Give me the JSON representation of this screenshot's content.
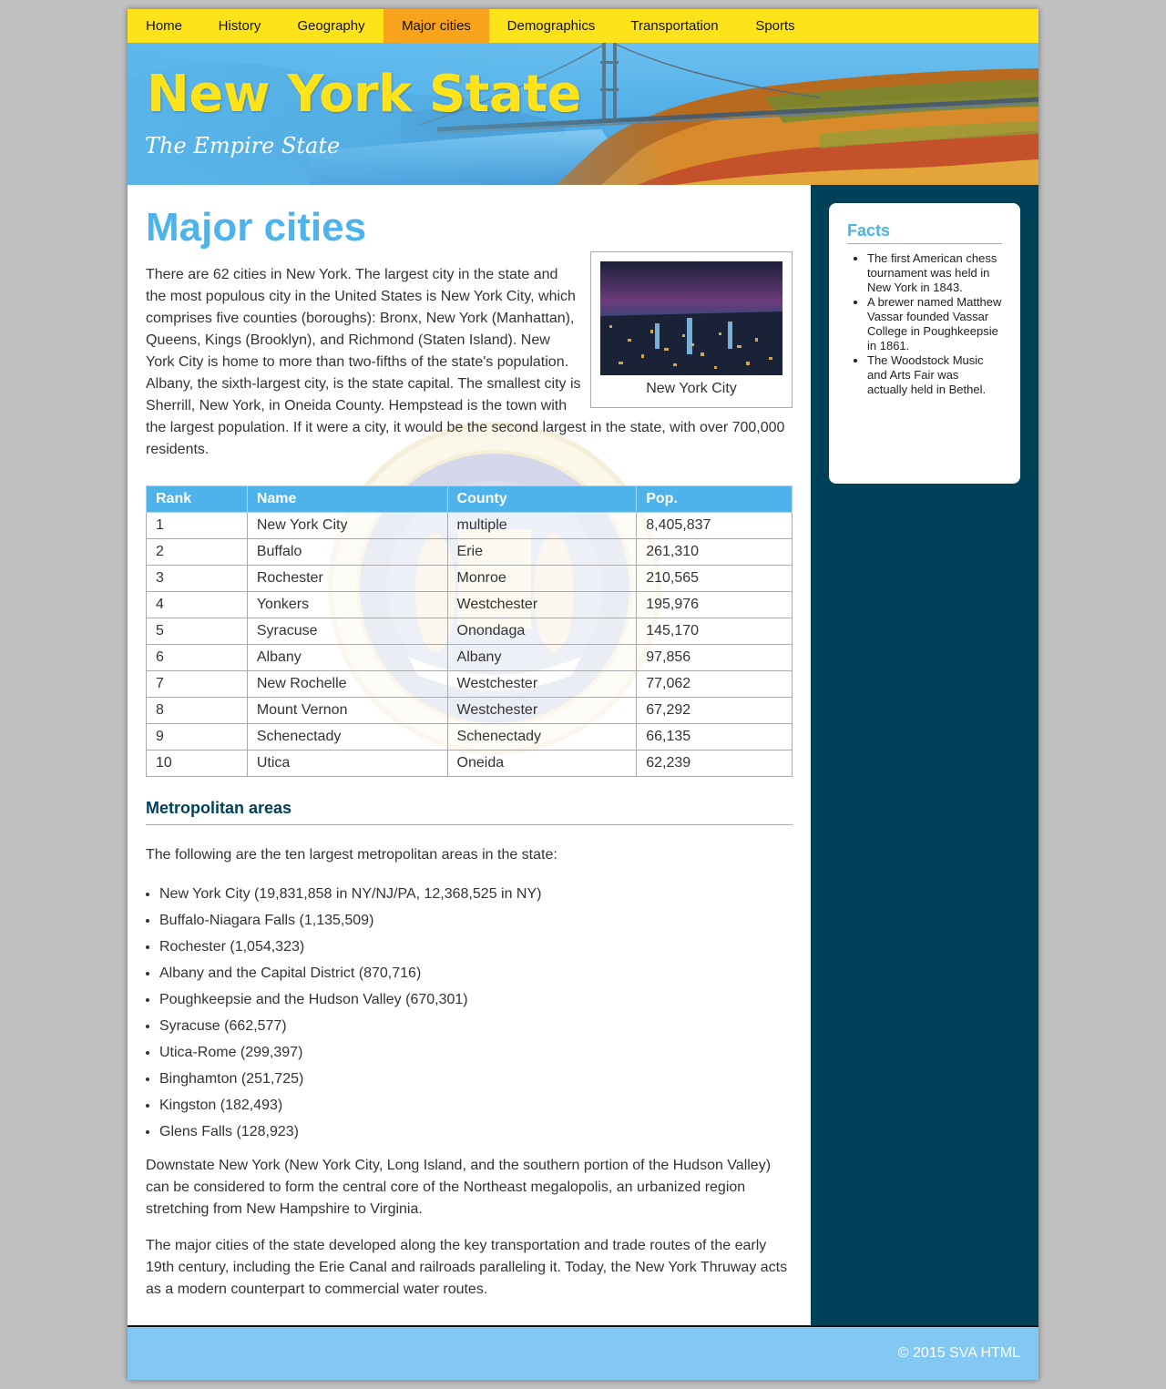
{
  "nav": {
    "items": [
      {
        "label": "Home",
        "active": false
      },
      {
        "label": "History",
        "active": false
      },
      {
        "label": "Geography",
        "active": false
      },
      {
        "label": "Major cities",
        "active": true
      },
      {
        "label": "Demographics",
        "active": false
      },
      {
        "label": "Transportation",
        "active": false
      },
      {
        "label": "Sports",
        "active": false
      }
    ]
  },
  "banner": {
    "title": "New York State",
    "tagline": "The Empire State"
  },
  "main": {
    "title": "Major cities",
    "intro": "There are 62 cities in New York. The largest city in the state and the most populous city in the United States is New York City, which comprises five counties (boroughs): Bronx, New York (Manhattan), Queens, Kings (Brooklyn), and Richmond (Staten Island). New York City is home to more than two-fifths of the state's population. Albany, the sixth-largest city, is the state capital. The smallest city is Sherrill, New York, in Oneida County. Hempstead is the town with the largest population. If it were a city, it would be the second largest in the state, with over 700,000 residents.",
    "figure_caption": "New York City",
    "table": {
      "headers": [
        "Rank",
        "Name",
        "County",
        "Pop."
      ],
      "rows": [
        [
          "1",
          "New York City",
          "multiple",
          "8,405,837"
        ],
        [
          "2",
          "Buffalo",
          "Erie",
          "261,310"
        ],
        [
          "3",
          "Rochester",
          "Monroe",
          "210,565"
        ],
        [
          "4",
          "Yonkers",
          "Westchester",
          "195,976"
        ],
        [
          "5",
          "Syracuse",
          "Onondaga",
          "145,170"
        ],
        [
          "6",
          "Albany",
          "Albany",
          "97,856"
        ],
        [
          "7",
          "New Rochelle",
          "Westchester",
          "77,062"
        ],
        [
          "8",
          "Mount Vernon",
          "Westchester",
          "67,292"
        ],
        [
          "9",
          "Schenectady",
          "Schenectady",
          "66,135"
        ],
        [
          "10",
          "Utica",
          "Oneida",
          "62,239"
        ]
      ]
    },
    "metro_heading": "Metropolitan areas",
    "metro_lead": "The following are the ten largest metropolitan areas in the state:",
    "metro_list": [
      "New York City (19,831,858 in NY/NJ/PA, 12,368,525 in NY)",
      "Buffalo-Niagara Falls (1,135,509)",
      "Rochester (1,054,323)",
      "Albany and the Capital District (870,716)",
      "Poughkeepsie and the Hudson Valley (670,301)",
      "Syracuse (662,577)",
      "Utica-Rome (299,397)",
      "Binghamton (251,725)",
      "Kingston (182,493)",
      "Glens Falls (128,923)"
    ],
    "para1": "Downstate New York (New York City, Long Island, and the southern portion of the Hudson Valley) can be considered to form the central core of the Northeast megalopolis, an urbanized region stretching from New Hampshire to Virginia.",
    "para2": "The major cities of the state developed along the key transportation and trade routes of the early 19th century, including the Erie Canal and railroads paralleling it. Today, the New York Thruway acts as a modern counterpart to commercial water routes."
  },
  "sidebar": {
    "facts_title": "Facts",
    "facts": [
      "The first American chess tournament was held in New York in 1843.",
      "A brewer named Matthew Vassar founded Vassar College in Poughkeepsie in 1861.",
      "The Woodstock Music and Arts Fair was actually held in Bethel."
    ]
  },
  "footer": {
    "copyright": "© 2015 SVA HTML"
  }
}
